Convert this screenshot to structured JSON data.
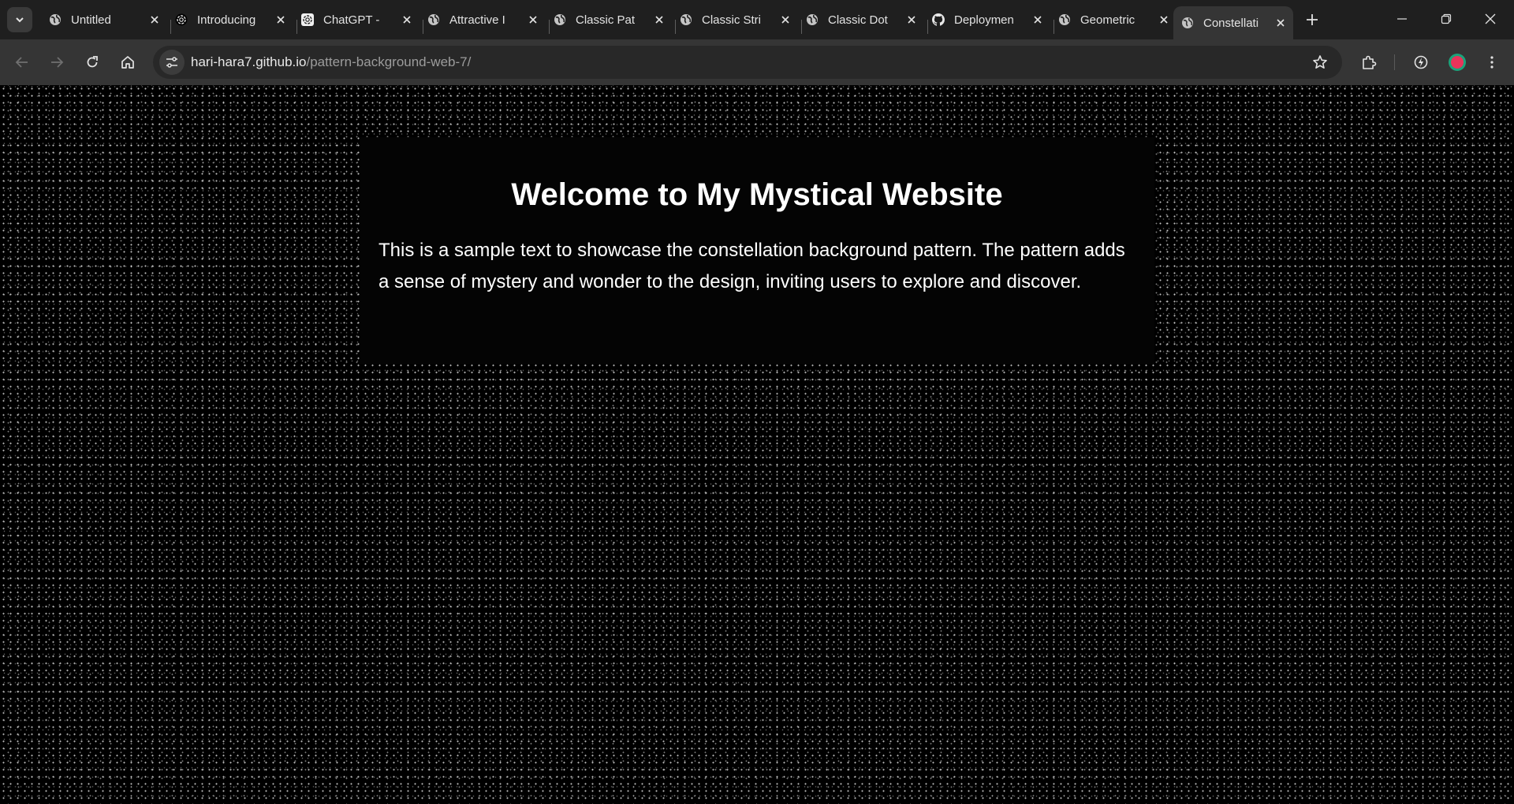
{
  "browser": {
    "tabs": [
      {
        "title": "Untitled",
        "icon": "globe-icon"
      },
      {
        "title": "Introducing",
        "icon": "openai-icon"
      },
      {
        "title": "ChatGPT -",
        "icon": "openai-icon"
      },
      {
        "title": "Attractive I",
        "icon": "globe-icon"
      },
      {
        "title": "Classic Pat",
        "icon": "globe-icon"
      },
      {
        "title": "Classic Stri",
        "icon": "globe-icon"
      },
      {
        "title": "Classic Dot",
        "icon": "globe-icon"
      },
      {
        "title": "Deploymen",
        "icon": "github-icon"
      },
      {
        "title": "Geometric",
        "icon": "globe-icon"
      },
      {
        "title": "Constellati",
        "icon": "globe-icon",
        "active": true
      }
    ],
    "address": {
      "host": "hari-hara7.github.io",
      "path": "/pattern-background-web-7/"
    },
    "profile_color": "#e8335a"
  },
  "page": {
    "heading": "Welcome to My Mystical Website",
    "body_text": "This is a sample text to showcase the constellation background pattern. The pattern adds a sense of mystery and wonder to the design, inviting users to explore and discover."
  }
}
